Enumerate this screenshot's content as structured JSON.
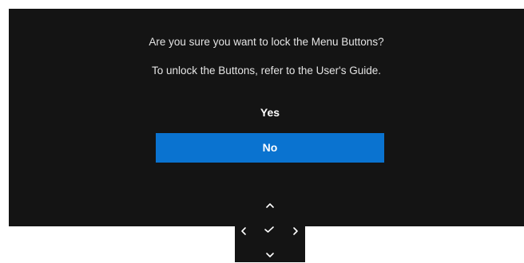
{
  "dialog": {
    "message_line1": "Are you sure you want to lock the Menu Buttons?",
    "message_line2": "To unlock the Buttons, refer to the User's Guide.",
    "options": [
      {
        "label": "Yes",
        "selected": false
      },
      {
        "label": "No",
        "selected": true
      }
    ]
  },
  "nav_pad": {
    "icons": [
      "chevron-up-icon",
      "chevron-left-icon",
      "checkmark-icon",
      "chevron-right-icon",
      "chevron-down-icon"
    ]
  },
  "colors": {
    "dialog_background": "#141414",
    "selected_highlight": "#0a73d0",
    "text": "#ffffff"
  }
}
